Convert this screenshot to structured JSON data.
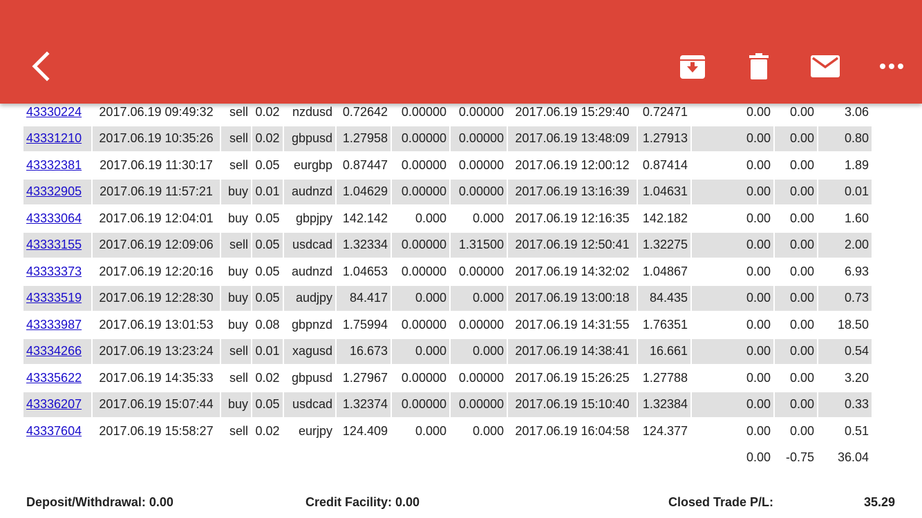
{
  "toolbar": {
    "back": "back-arrow-icon",
    "archive": "archive-icon",
    "delete": "trash-icon",
    "mail": "mail-icon",
    "more": "more-horiz-icon",
    "accent_color": "#dc4538"
  },
  "trades": [
    {
      "ticket": "43330224",
      "open_time": "2017.06.19 09:49:32",
      "type": "sell",
      "size": "0.02",
      "item": "nzdusd",
      "open_price": "0.72642",
      "sl": "0.00000",
      "tp": "0.00000",
      "close_time": "2017.06.19 15:29:40",
      "close_price": "0.72471",
      "commission": "0.00",
      "swap": "0.00",
      "profit": "3.06"
    },
    {
      "ticket": "43331210",
      "open_time": "2017.06.19 10:35:26",
      "type": "sell",
      "size": "0.02",
      "item": "gbpusd",
      "open_price": "1.27958",
      "sl": "0.00000",
      "tp": "0.00000",
      "close_time": "2017.06.19 13:48:09",
      "close_price": "1.27913",
      "commission": "0.00",
      "swap": "0.00",
      "profit": "0.80"
    },
    {
      "ticket": "43332381",
      "open_time": "2017.06.19 11:30:17",
      "type": "sell",
      "size": "0.05",
      "item": "eurgbp",
      "open_price": "0.87447",
      "sl": "0.00000",
      "tp": "0.00000",
      "close_time": "2017.06.19 12:00:12",
      "close_price": "0.87414",
      "commission": "0.00",
      "swap": "0.00",
      "profit": "1.89"
    },
    {
      "ticket": "43332905",
      "open_time": "2017.06.19 11:57:21",
      "type": "buy",
      "size": "0.01",
      "item": "audnzd",
      "open_price": "1.04629",
      "sl": "0.00000",
      "tp": "0.00000",
      "close_time": "2017.06.19 13:16:39",
      "close_price": "1.04631",
      "commission": "0.00",
      "swap": "0.00",
      "profit": "0.01"
    },
    {
      "ticket": "43333064",
      "open_time": "2017.06.19 12:04:01",
      "type": "buy",
      "size": "0.05",
      "item": "gbpjpy",
      "open_price": "142.142",
      "sl": "0.000",
      "tp": "0.000",
      "close_time": "2017.06.19 12:16:35",
      "close_price": "142.182",
      "commission": "0.00",
      "swap": "0.00",
      "profit": "1.60"
    },
    {
      "ticket": "43333155",
      "open_time": "2017.06.19 12:09:06",
      "type": "sell",
      "size": "0.05",
      "item": "usdcad",
      "open_price": "1.32334",
      "sl": "0.00000",
      "tp": "1.31500",
      "close_time": "2017.06.19 12:50:41",
      "close_price": "1.32275",
      "commission": "0.00",
      "swap": "0.00",
      "profit": "2.00"
    },
    {
      "ticket": "43333373",
      "open_time": "2017.06.19 12:20:16",
      "type": "buy",
      "size": "0.05",
      "item": "audnzd",
      "open_price": "1.04653",
      "sl": "0.00000",
      "tp": "0.00000",
      "close_time": "2017.06.19 14:32:02",
      "close_price": "1.04867",
      "commission": "0.00",
      "swap": "0.00",
      "profit": "6.93"
    },
    {
      "ticket": "43333519",
      "open_time": "2017.06.19 12:28:30",
      "type": "buy",
      "size": "0.05",
      "item": "audjpy",
      "open_price": "84.417",
      "sl": "0.000",
      "tp": "0.000",
      "close_time": "2017.06.19 13:00:18",
      "close_price": "84.435",
      "commission": "0.00",
      "swap": "0.00",
      "profit": "0.73"
    },
    {
      "ticket": "43333987",
      "open_time": "2017.06.19 13:01:53",
      "type": "buy",
      "size": "0.08",
      "item": "gbpnzd",
      "open_price": "1.75994",
      "sl": "0.00000",
      "tp": "0.00000",
      "close_time": "2017.06.19 14:31:55",
      "close_price": "1.76351",
      "commission": "0.00",
      "swap": "0.00",
      "profit": "18.50"
    },
    {
      "ticket": "43334266",
      "open_time": "2017.06.19 13:23:24",
      "type": "sell",
      "size": "0.01",
      "item": "xagusd",
      "open_price": "16.673",
      "sl": "0.000",
      "tp": "0.000",
      "close_time": "2017.06.19 14:38:41",
      "close_price": "16.661",
      "commission": "0.00",
      "swap": "0.00",
      "profit": "0.54"
    },
    {
      "ticket": "43335622",
      "open_time": "2017.06.19 14:35:33",
      "type": "sell",
      "size": "0.02",
      "item": "gbpusd",
      "open_price": "1.27967",
      "sl": "0.00000",
      "tp": "0.00000",
      "close_time": "2017.06.19 15:26:25",
      "close_price": "1.27788",
      "commission": "0.00",
      "swap": "0.00",
      "profit": "3.20"
    },
    {
      "ticket": "43336207",
      "open_time": "2017.06.19 15:07:44",
      "type": "buy",
      "size": "0.05",
      "item": "usdcad",
      "open_price": "1.32374",
      "sl": "0.00000",
      "tp": "0.00000",
      "close_time": "2017.06.19 15:10:40",
      "close_price": "1.32384",
      "commission": "0.00",
      "swap": "0.00",
      "profit": "0.33"
    },
    {
      "ticket": "43337604",
      "open_time": "2017.06.19 15:58:27",
      "type": "sell",
      "size": "0.02",
      "item": "eurjpy",
      "open_price": "124.409",
      "sl": "0.000",
      "tp": "0.000",
      "close_time": "2017.06.19 16:04:58",
      "close_price": "124.377",
      "commission": "0.00",
      "swap": "0.00",
      "profit": "0.51"
    }
  ],
  "totals": {
    "commission": "0.00",
    "swap": "-0.75",
    "profit": "36.04"
  },
  "summary": {
    "deposit": "Deposit/Withdrawal: 0.00",
    "credit": "Credit Facility: 0.00",
    "closed_pl_label": "Closed Trade P/L:",
    "closed_pl_value": "35.29"
  }
}
